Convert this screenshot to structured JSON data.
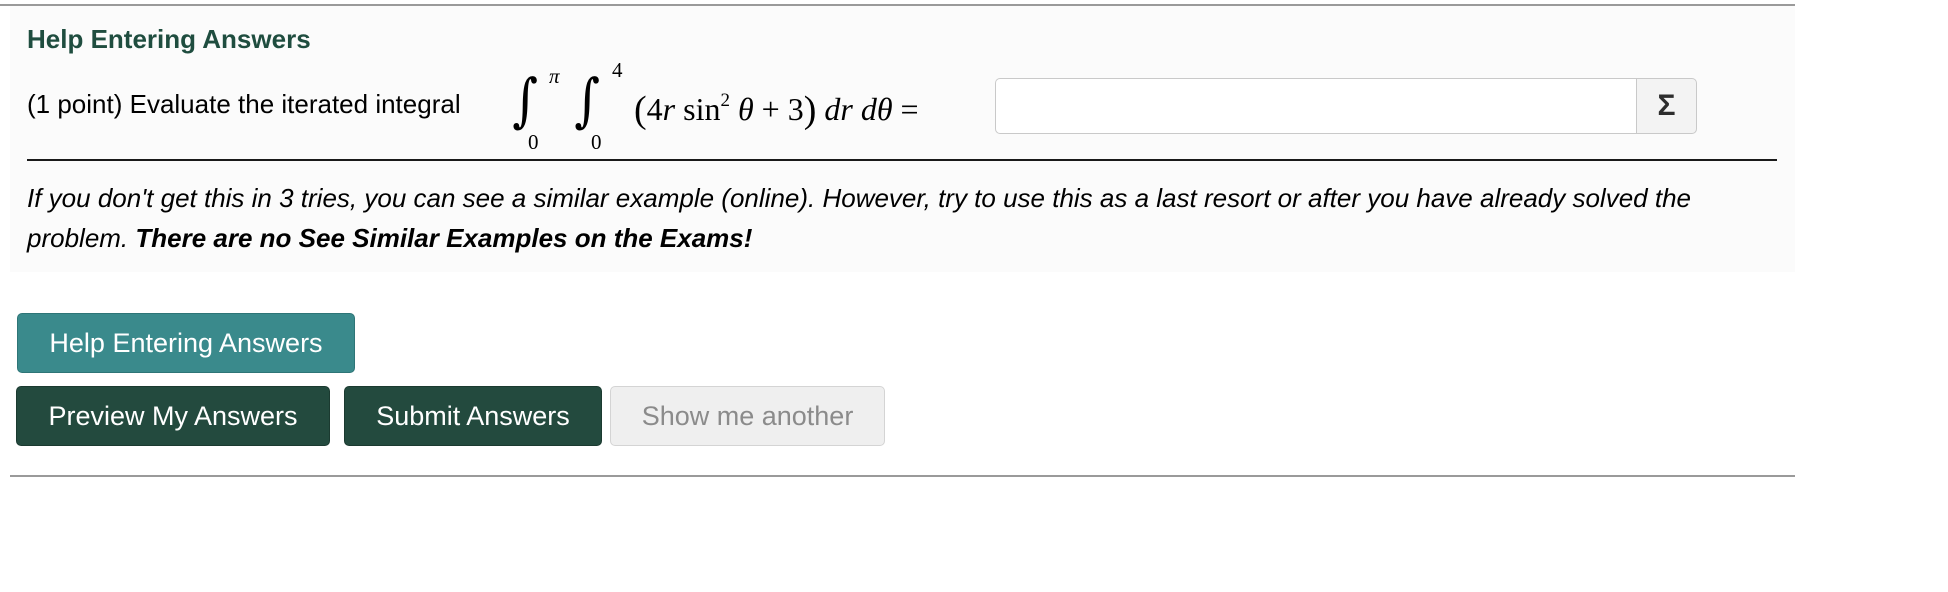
{
  "section_title": "Help Entering Answers",
  "question": {
    "prefix": "(1 point) Evaluate the iterated integral",
    "outer_upper": "π",
    "outer_lower": "0",
    "inner_upper": "4",
    "inner_lower": "0",
    "integrand_open": "(",
    "integrand_coef": "4",
    "integrand_var": "r",
    "integrand_fn": " sin",
    "integrand_power": "2",
    "integrand_theta": " θ",
    "integrand_rest": " + 3",
    "integrand_close": ")",
    "differentials": "  dr dθ",
    "equals": " =",
    "answer_value": "",
    "answer_placeholder": ""
  },
  "equation_editor_icon": "sigma-icon",
  "equation_editor_glyph": "Σ",
  "note": {
    "text": "If you don't get this in 3 tries, you can see a similar example (online). However, try to use this as a last resort or after you have already solved the problem. ",
    "bold": "There are no See Similar Examples on the Exams!"
  },
  "buttons": {
    "help": "Help Entering Answers",
    "preview": "Preview My Answers",
    "submit": "Submit Answers",
    "another": "Show me another"
  },
  "colors": {
    "title_green": "#1f4d3f",
    "help_teal": "#3a8a8c",
    "primary_dark_green": "#234a3e",
    "disabled_gray": "#efefef"
  }
}
